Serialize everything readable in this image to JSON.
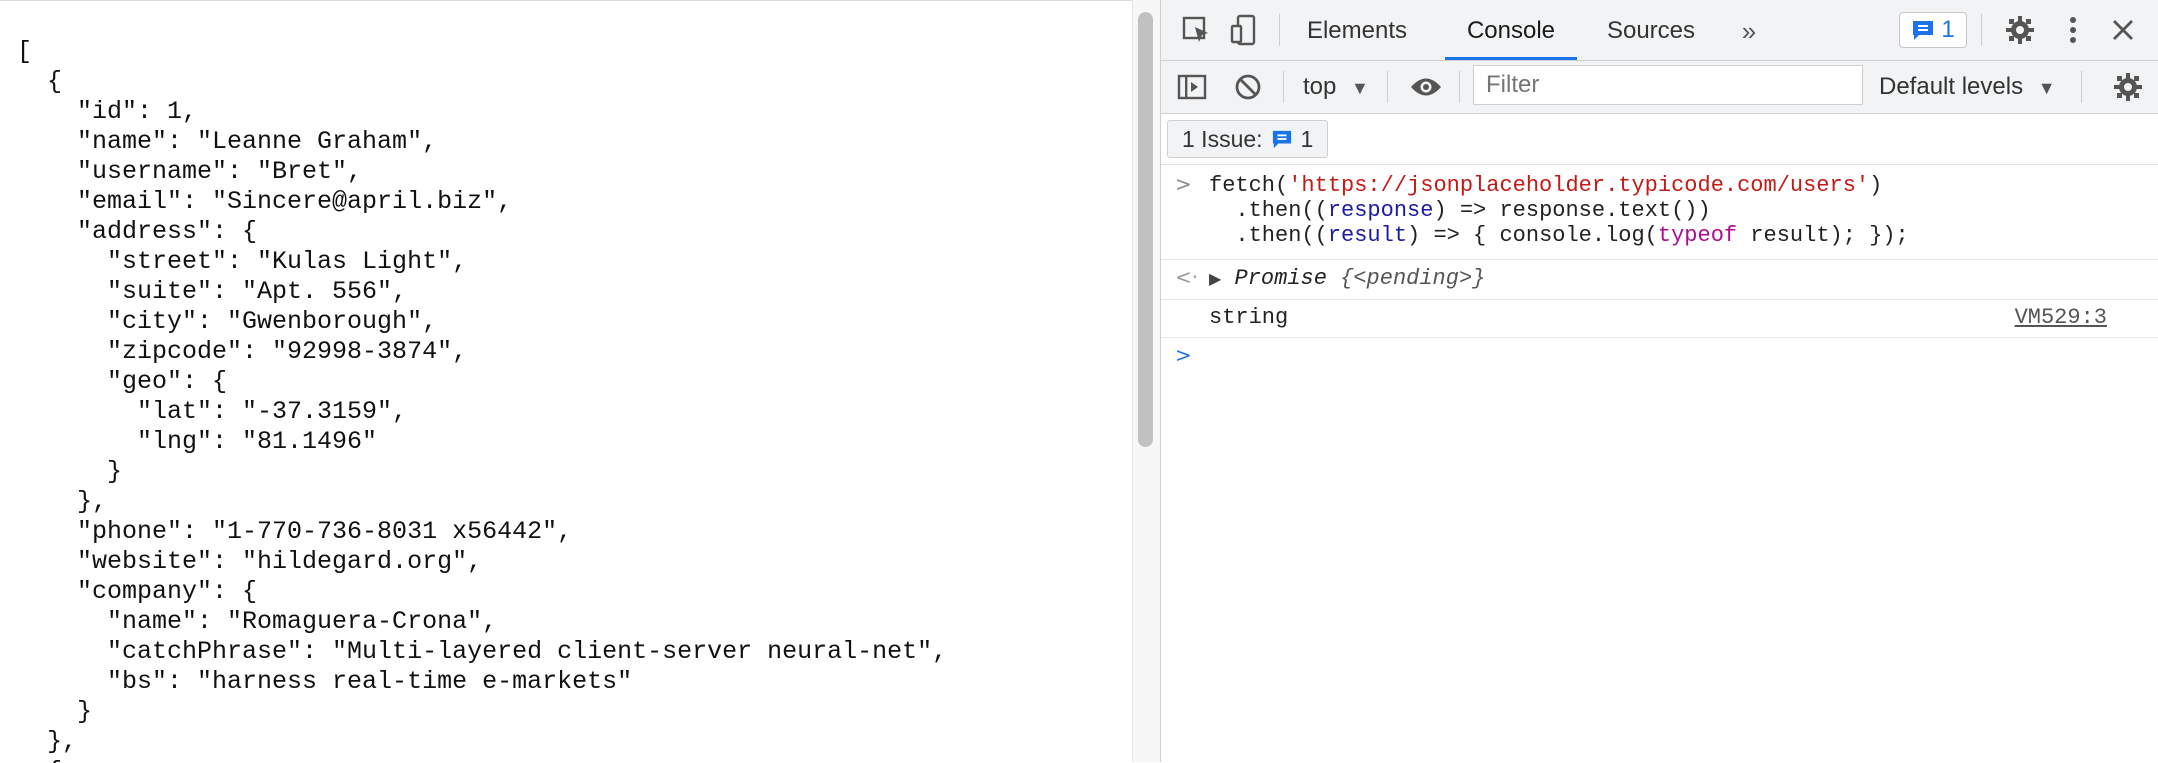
{
  "json_lines": [
    "[",
    "  {",
    "    \"id\": 1,",
    "    \"name\": \"Leanne Graham\",",
    "    \"username\": \"Bret\",",
    "    \"email\": \"Sincere@april.biz\",",
    "    \"address\": {",
    "      \"street\": \"Kulas Light\",",
    "      \"suite\": \"Apt. 556\",",
    "      \"city\": \"Gwenborough\",",
    "      \"zipcode\": \"92998-3874\",",
    "      \"geo\": {",
    "        \"lat\": \"-37.3159\",",
    "        \"lng\": \"81.1496\"",
    "      }",
    "    },",
    "    \"phone\": \"1-770-736-8031 x56442\",",
    "    \"website\": \"hildegard.org\",",
    "    \"company\": {",
    "      \"name\": \"Romaguera-Crona\",",
    "      \"catchPhrase\": \"Multi-layered client-server neural-net\",",
    "      \"bs\": \"harness real-time e-markets\"",
    "    }",
    "  },",
    "  {"
  ],
  "devtools": {
    "tabs": [
      "Elements",
      "Console",
      "Sources"
    ],
    "active_tab": "Console",
    "more_tabs": "»",
    "issues_badge_count": "1",
    "context": "top",
    "filter_placeholder": "Filter",
    "levels": "Default levels",
    "issues_label": "1 Issue:",
    "issues_count": "1"
  },
  "console": {
    "input": {
      "l1_a": "fetch(",
      "l1_url": "'https://jsonplaceholder.typicode.com/users'",
      "l1_b": ")",
      "l2_a": "  .then((",
      "l2_param": "response",
      "l2_b": ") => response.text())",
      "l3_a": "  .then((",
      "l3_param": "result",
      "l3_b": ") => { console.log(",
      "l3_kw": "typeof",
      "l3_c": " result); });"
    },
    "promise_prefix": "Promise ",
    "promise_state": "{<pending>}",
    "log_text": "string",
    "log_source": "VM529:3"
  },
  "colors": {
    "accent": "#1a73e8",
    "string": "#c41a16",
    "keyword": "#aa0d91",
    "param": "#1a1aa6"
  }
}
